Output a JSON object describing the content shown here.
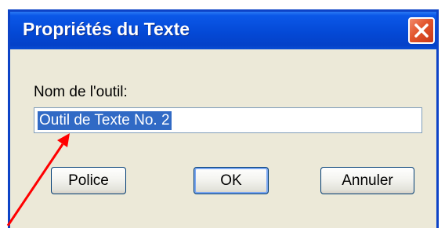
{
  "dialog": {
    "title": "Propriétés du Texte",
    "field_label": "Nom de l'outil:",
    "field_value": "Outil de Texte No. 2"
  },
  "buttons": {
    "police": "Police",
    "ok": "OK",
    "annuler": "Annuler"
  },
  "annotation": {
    "arrow_color": "#ff0000"
  }
}
